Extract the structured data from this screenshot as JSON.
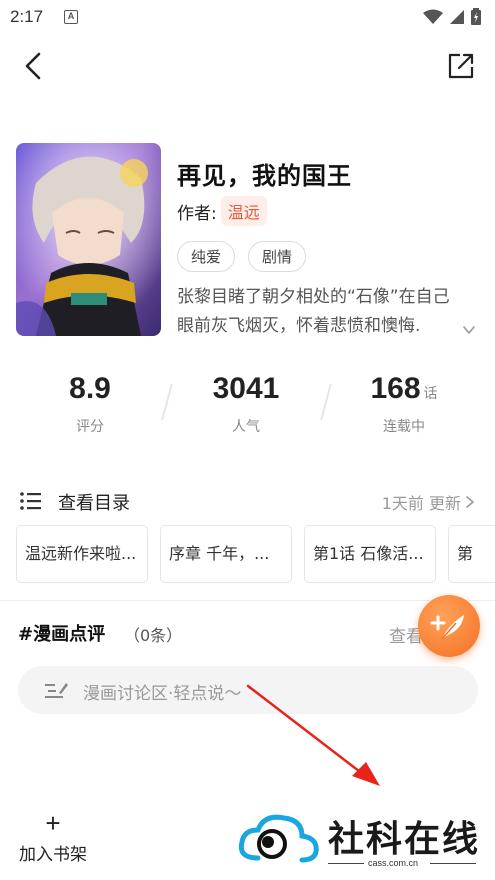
{
  "status_bar": {
    "time": "2:17",
    "notif_letter": "A"
  },
  "comic": {
    "title": "再见，我的国王",
    "author_label": "作者:",
    "author": "温远",
    "tags": [
      "纯爱",
      "剧情"
    ],
    "description_lines": [
      "张黎目睹了朝夕相处的“石像”在自己",
      "眼前灰飞烟灭，怀着悲愤和懊悔."
    ]
  },
  "stats": [
    {
      "value": "8.9",
      "unit": "",
      "label": "评分"
    },
    {
      "value": "3041",
      "unit": "",
      "label": "人气"
    },
    {
      "value": "168",
      "unit": "话",
      "label": "连载中"
    }
  ],
  "catalog": {
    "label": "查看目录",
    "update": "1天前 更新",
    "chapters": [
      "温远新作来啦...",
      "序章  千年，...",
      "第1话  石像活...",
      "第"
    ]
  },
  "review": {
    "title": "#漫画点评",
    "count": "（0条）",
    "view_all": "查看",
    "placeholder": "漫画讨论区·轻点说～"
  },
  "bottom": {
    "shelf_label": "加入书架"
  },
  "watermark": {
    "text": "社科在线",
    "sub": "cass.com.cn"
  },
  "colors": {
    "accent": "#e8593c",
    "fab": "#f37023",
    "arrow": "#e8231a"
  }
}
